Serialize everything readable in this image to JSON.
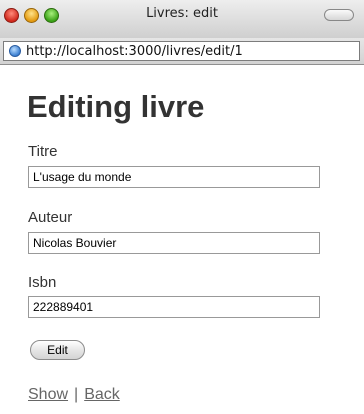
{
  "window": {
    "title": "Livres: edit",
    "url": "http://localhost:3000/livres/edit/1"
  },
  "page": {
    "heading": "Editing livre",
    "fields": [
      {
        "label": "Titre",
        "value": "L'usage du monde"
      },
      {
        "label": "Auteur",
        "value": "Nicolas Bouvier"
      },
      {
        "label": "Isbn",
        "value": "222889401"
      }
    ],
    "submit_label": "Edit",
    "links": {
      "show": "Show",
      "separator": "|",
      "back": "Back"
    }
  },
  "icons": {
    "close": "close-icon",
    "minimize": "minimize-icon",
    "zoom": "zoom-icon",
    "toolbar_toggle": "toolbar-toggle-icon",
    "site": "globe-icon"
  },
  "colors": {
    "desktop": "#1e2c6a",
    "heading": "#333333",
    "link": "#666666"
  }
}
